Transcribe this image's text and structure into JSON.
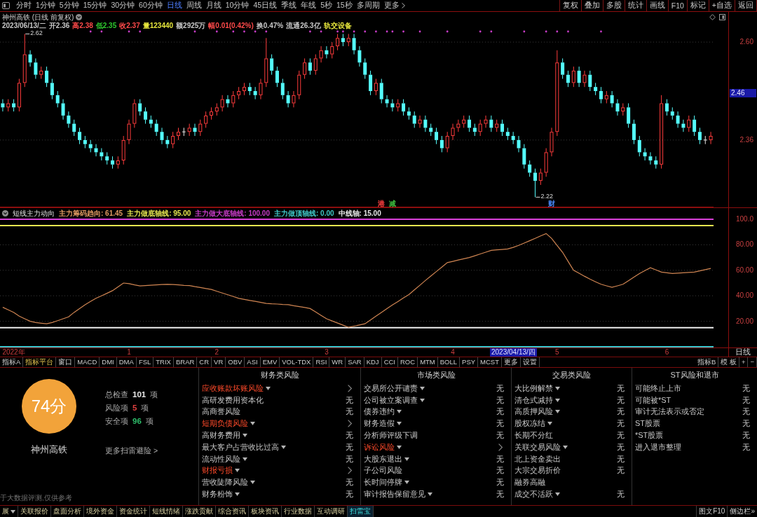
{
  "toolbar": {
    "periods": [
      {
        "label": "分时",
        "selected": false
      },
      {
        "label": "1分钟",
        "selected": false
      },
      {
        "label": "5分钟",
        "selected": false
      },
      {
        "label": "15分钟",
        "selected": false
      },
      {
        "label": "30分钟",
        "selected": false
      },
      {
        "label": "60分钟",
        "selected": false
      },
      {
        "label": "日线",
        "selected": true
      },
      {
        "label": "周线",
        "selected": false
      },
      {
        "label": "月线",
        "selected": false
      },
      {
        "label": "10分钟",
        "selected": false
      },
      {
        "label": "45日线",
        "selected": false
      },
      {
        "label": "季线",
        "selected": false
      },
      {
        "label": "年线",
        "selected": false
      },
      {
        "label": "5秒",
        "selected": false
      },
      {
        "label": "15秒",
        "selected": false
      },
      {
        "label": "多周期",
        "selected": false
      }
    ],
    "more": "更多",
    "actions": [
      "复权",
      "叠加",
      "多股",
      "统计",
      "画线",
      "F10",
      "标记",
      "+自选",
      "返回"
    ]
  },
  "price_pane": {
    "title": "神州高铁 (日线 前复权)",
    "quote": [
      {
        "text": "2023/06/13/二",
        "color": "#c8c8c8"
      },
      {
        "text": "开2.36",
        "color": "#c8c8c8"
      },
      {
        "text": "高2.38",
        "color": "#ff4a4a"
      },
      {
        "text": "低2.35",
        "color": "#2ec82e"
      },
      {
        "text": "收2.37",
        "color": "#ff4a4a"
      },
      {
        "text": "量123440",
        "color": "#e6e63c"
      },
      {
        "text": "额2925万",
        "color": "#c8c8c8"
      },
      {
        "text": "幅0.01(0.42%)",
        "color": "#ff4a4a"
      },
      {
        "text": "换0.47%",
        "color": "#c8c8c8"
      },
      {
        "text": "流通26.3亿",
        "color": "#c8c8c8"
      },
      {
        "text": "轨交设备",
        "color": "#e6e63c"
      }
    ],
    "cursor_price": "2.46",
    "event_tags": [
      {
        "label": "港",
        "color": "#ff4040"
      },
      {
        "label": "减",
        "color": "#40c040"
      },
      {
        "label": "财",
        "color": "#4a8cff"
      }
    ],
    "chart_data": [
      {
        "type": "candlestick",
        "ylim": [
          2.195,
          2.674
        ],
        "yticks": [
          {
            "value": 2.6,
            "label": "2.60"
          },
          {
            "value": 2.36,
            "label": "2.36"
          }
        ],
        "grid": true,
        "annotations": [
          "2.62",
          "2.22"
        ],
        "ohlc": [
          [
            2.45,
            2.46,
            2.43,
            2.44
          ],
          [
            2.44,
            2.46,
            2.43,
            2.45
          ],
          [
            2.45,
            2.46,
            2.43,
            2.44
          ],
          [
            2.44,
            2.51,
            2.43,
            2.5
          ],
          [
            2.5,
            2.62,
            2.49,
            2.57
          ],
          [
            2.57,
            2.58,
            2.54,
            2.55
          ],
          [
            2.55,
            2.56,
            2.51,
            2.52
          ],
          [
            2.52,
            2.54,
            2.51,
            2.53
          ],
          [
            2.53,
            2.54,
            2.49,
            2.5
          ],
          [
            2.5,
            2.51,
            2.46,
            2.47
          ],
          [
            2.47,
            2.48,
            2.44,
            2.45
          ],
          [
            2.45,
            2.46,
            2.41,
            2.42
          ],
          [
            2.42,
            2.43,
            2.39,
            2.4
          ],
          [
            2.4,
            2.41,
            2.37,
            2.38
          ],
          [
            2.38,
            2.39,
            2.35,
            2.36
          ],
          [
            2.36,
            2.37,
            2.34,
            2.35
          ],
          [
            2.35,
            2.36,
            2.33,
            2.34
          ],
          [
            2.34,
            2.35,
            2.32,
            2.33
          ],
          [
            2.33,
            2.34,
            2.31,
            2.32
          ],
          [
            2.32,
            2.33,
            2.3,
            2.31
          ],
          [
            2.31,
            2.32,
            2.29,
            2.3
          ],
          [
            2.3,
            2.32,
            2.29,
            2.31
          ],
          [
            2.31,
            2.37,
            2.3,
            2.36
          ],
          [
            2.36,
            2.41,
            2.35,
            2.4
          ],
          [
            2.4,
            2.46,
            2.39,
            2.45
          ],
          [
            2.45,
            2.46,
            2.42,
            2.43
          ],
          [
            2.43,
            2.44,
            2.4,
            2.41
          ],
          [
            2.41,
            2.42,
            2.39,
            2.4
          ],
          [
            2.4,
            2.41,
            2.37,
            2.38
          ],
          [
            2.38,
            2.39,
            2.35,
            2.36
          ],
          [
            2.36,
            2.37,
            2.34,
            2.35
          ],
          [
            2.35,
            2.38,
            2.34,
            2.37
          ],
          [
            2.37,
            2.39,
            2.36,
            2.38
          ],
          [
            2.38,
            2.39,
            2.37,
            2.38
          ],
          [
            2.38,
            2.4,
            2.37,
            2.39
          ],
          [
            2.39,
            2.4,
            2.37,
            2.38
          ],
          [
            2.38,
            2.41,
            2.37,
            2.4
          ],
          [
            2.4,
            2.43,
            2.39,
            2.42
          ],
          [
            2.42,
            2.44,
            2.41,
            2.43
          ],
          [
            2.43,
            2.45,
            2.42,
            2.44
          ],
          [
            2.44,
            2.47,
            2.43,
            2.46
          ],
          [
            2.46,
            2.47,
            2.44,
            2.45
          ],
          [
            2.45,
            2.48,
            2.44,
            2.47
          ],
          [
            2.47,
            2.49,
            2.46,
            2.48
          ],
          [
            2.48,
            2.5,
            2.47,
            2.49
          ],
          [
            2.49,
            2.5,
            2.47,
            2.48
          ],
          [
            2.48,
            2.49,
            2.46,
            2.47
          ],
          [
            2.47,
            2.51,
            2.46,
            2.5
          ],
          [
            2.5,
            2.61,
            2.49,
            2.56
          ],
          [
            2.56,
            2.57,
            2.52,
            2.53
          ],
          [
            2.53,
            2.54,
            2.49,
            2.5
          ],
          [
            2.5,
            2.51,
            2.46,
            2.47
          ],
          [
            2.47,
            2.48,
            2.44,
            2.45
          ],
          [
            2.45,
            2.48,
            2.44,
            2.47
          ],
          [
            2.47,
            2.53,
            2.46,
            2.52
          ],
          [
            2.52,
            2.56,
            2.51,
            2.55
          ],
          [
            2.55,
            2.56,
            2.52,
            2.53
          ],
          [
            2.53,
            2.57,
            2.52,
            2.56
          ],
          [
            2.56,
            2.59,
            2.55,
            2.58
          ],
          [
            2.58,
            2.59,
            2.56,
            2.57
          ],
          [
            2.57,
            2.6,
            2.56,
            2.59
          ],
          [
            2.59,
            2.62,
            2.58,
            2.61
          ],
          [
            2.61,
            2.62,
            2.59,
            2.6
          ],
          [
            2.6,
            2.62,
            2.59,
            2.61
          ],
          [
            2.61,
            2.62,
            2.57,
            2.58
          ],
          [
            2.58,
            2.59,
            2.54,
            2.55
          ],
          [
            2.55,
            2.56,
            2.51,
            2.52
          ],
          [
            2.52,
            2.53,
            2.47,
            2.48
          ],
          [
            2.48,
            2.51,
            2.47,
            2.5
          ],
          [
            2.5,
            2.51,
            2.45,
            2.46
          ],
          [
            2.46,
            2.47,
            2.44,
            2.45
          ],
          [
            2.45,
            2.46,
            2.43,
            2.44
          ],
          [
            2.44,
            2.46,
            2.43,
            2.45
          ],
          [
            2.45,
            2.46,
            2.42,
            2.43
          ],
          [
            2.43,
            2.44,
            2.41,
            2.42
          ],
          [
            2.42,
            2.43,
            2.39,
            2.4
          ],
          [
            2.4,
            2.42,
            2.39,
            2.41
          ],
          [
            2.41,
            2.42,
            2.38,
            2.39
          ],
          [
            2.39,
            2.4,
            2.37,
            2.38
          ],
          [
            2.38,
            2.39,
            2.35,
            2.36
          ],
          [
            2.36,
            2.37,
            2.33,
            2.34
          ],
          [
            2.34,
            2.38,
            2.33,
            2.37
          ],
          [
            2.37,
            2.4,
            2.36,
            2.39
          ],
          [
            2.39,
            2.41,
            2.38,
            2.4
          ],
          [
            2.4,
            2.42,
            2.39,
            2.41
          ],
          [
            2.41,
            2.42,
            2.38,
            2.39
          ],
          [
            2.39,
            2.4,
            2.37,
            2.38
          ],
          [
            2.38,
            2.41,
            2.37,
            2.4
          ],
          [
            2.4,
            2.42,
            2.39,
            2.41
          ],
          [
            2.41,
            2.42,
            2.38,
            2.39
          ],
          [
            2.39,
            2.41,
            2.38,
            2.4
          ],
          [
            2.4,
            2.41,
            2.37,
            2.38
          ],
          [
            2.38,
            2.39,
            2.36,
            2.37
          ],
          [
            2.37,
            2.38,
            2.35,
            2.36
          ],
          [
            2.36,
            2.37,
            2.33,
            2.34
          ],
          [
            2.34,
            2.35,
            2.29,
            2.3
          ],
          [
            2.3,
            2.31,
            2.27,
            2.28
          ],
          [
            2.28,
            2.29,
            2.22,
            2.26
          ],
          [
            2.26,
            2.29,
            2.25,
            2.28
          ],
          [
            2.28,
            2.34,
            2.27,
            2.33
          ],
          [
            2.33,
            2.39,
            2.32,
            2.38
          ],
          [
            2.38,
            2.58,
            2.37,
            2.55
          ],
          [
            2.55,
            2.56,
            2.51,
            2.52
          ],
          [
            2.52,
            2.53,
            2.49,
            2.5
          ],
          [
            2.5,
            2.54,
            2.49,
            2.53
          ],
          [
            2.53,
            2.54,
            2.49,
            2.5
          ],
          [
            2.5,
            2.53,
            2.49,
            2.52
          ],
          [
            2.52,
            2.53,
            2.48,
            2.49
          ],
          [
            2.49,
            2.5,
            2.47,
            2.48
          ],
          [
            2.48,
            2.49,
            2.45,
            2.46
          ],
          [
            2.46,
            2.48,
            2.45,
            2.47
          ],
          [
            2.47,
            2.48,
            2.44,
            2.45
          ],
          [
            2.45,
            2.46,
            2.42,
            2.43
          ],
          [
            2.43,
            2.45,
            2.42,
            2.44
          ],
          [
            2.44,
            2.45,
            2.39,
            2.4
          ],
          [
            2.4,
            2.41,
            2.35,
            2.36
          ],
          [
            2.36,
            2.37,
            2.32,
            2.33
          ],
          [
            2.33,
            2.34,
            2.31,
            2.32
          ],
          [
            2.32,
            2.33,
            2.3,
            2.31
          ],
          [
            2.31,
            2.32,
            2.29,
            2.3
          ],
          [
            2.3,
            2.47,
            2.29,
            2.45
          ],
          [
            2.45,
            2.46,
            2.42,
            2.43
          ],
          [
            2.43,
            2.44,
            2.41,
            2.42
          ],
          [
            2.42,
            2.43,
            2.39,
            2.4
          ],
          [
            2.4,
            2.41,
            2.38,
            2.39
          ],
          [
            2.39,
            2.42,
            2.38,
            2.41
          ],
          [
            2.41,
            2.42,
            2.37,
            2.38
          ],
          [
            2.38,
            2.39,
            2.35,
            2.36
          ],
          [
            2.36,
            2.37,
            2.35,
            2.36
          ],
          [
            2.36,
            2.38,
            2.35,
            2.37
          ]
        ]
      }
    ]
  },
  "indicator_pane": {
    "title": "短线主力动向",
    "legend": [
      {
        "label": "主力筹码趋向: 61.45",
        "color": "#e09a62"
      },
      {
        "label": "主力做底轴线: 95.00",
        "color": "#e6e650"
      },
      {
        "label": "主力做大底轴线: 100.00",
        "color": "#c83cc8"
      },
      {
        "label": "主力做顶轴线: 0.00",
        "color": "#40c8c8"
      },
      {
        "label": "中线轴: 15.00",
        "color": "#e8e8e8"
      }
    ],
    "chart_data": [
      {
        "type": "line",
        "ylim": [
          -0.55,
          108.8
        ],
        "yticks": [
          {
            "value": 100,
            "label": "100.0"
          },
          {
            "value": 80,
            "label": "80.00"
          },
          {
            "value": 60,
            "label": "60.00"
          },
          {
            "value": 40,
            "label": "40.00"
          },
          {
            "value": 20,
            "label": "20.00"
          }
        ],
        "grid": true,
        "categories": [
          null,
          null,
          "2022年",
          null,
          null,
          null,
          null,
          null,
          null,
          null,
          null,
          null,
          null,
          null,
          null,
          null,
          null,
          null,
          null,
          null,
          null,
          null,
          null,
          "1",
          null,
          null,
          null,
          null,
          null,
          null,
          null,
          null,
          null,
          null,
          null,
          null,
          null,
          null,
          null,
          "2",
          null,
          null,
          null,
          null,
          null,
          null,
          null,
          null,
          null,
          null,
          null,
          null,
          null,
          null,
          null,
          null,
          null,
          null,
          null,
          "3",
          null,
          null,
          null,
          null,
          null,
          null,
          null,
          null,
          null,
          null,
          null,
          null,
          null,
          null,
          null,
          null,
          null,
          null,
          null,
          null,
          null,
          null,
          "4",
          null,
          null,
          null,
          null,
          null,
          null,
          null,
          null,
          null,
          null,
          null,
          null,
          null,
          null,
          null,
          null,
          null,
          null,
          "5",
          null,
          null,
          null,
          null,
          null,
          null,
          null,
          null,
          null,
          null,
          null,
          null,
          null,
          null,
          null,
          null,
          null,
          null,
          null,
          "6",
          null,
          null,
          null,
          null,
          null,
          null,
          null,
          null
        ],
        "series": [
          {
            "color": "#d08552",
            "values": [
              31,
              29,
              27,
              24,
              22,
              20,
              19,
              18.5,
              18,
              19,
              20.5,
              22,
              23.5,
              27,
              30,
              33,
              35.6,
              38,
              40,
              42,
              44,
              47,
              50,
              49.5,
              48.5,
              47.7,
              48,
              48.3,
              48.6,
              48.8,
              49,
              48.8,
              48.5,
              48.2,
              48,
              47.2,
              46.5,
              45.7,
              45,
              43.6,
              42.2,
              40.8,
              39.4,
              38,
              37.2,
              36.4,
              35.6,
              34.8,
              34,
              33.7,
              33.5,
              33.2,
              33,
              32.2,
              31.5,
              30.8,
              30,
              27.3,
              24.6,
              22,
              20.3,
              18.6,
              17,
              15.3,
              16.2,
              17.1,
              18,
              21,
              24,
              27,
              30,
              32.8,
              35.5,
              38.3,
              41,
              44.7,
              48.3,
              52,
              55.5,
              59,
              62.5,
              66,
              67,
              68,
              69,
              70,
              71.4,
              72.8,
              74.2,
              75.6,
              76,
              76.3,
              76.7,
              78,
              79.5,
              81.3,
              83.2,
              85,
              87,
              88.8,
              85,
              79.5,
              74,
              67,
              60,
              57.7,
              55.3,
              53,
              51,
              49,
              47.8,
              46.6,
              47.8,
              49,
              51.8,
              54.7,
              57.5,
              59.8,
              62,
              60.3,
              58.6,
              58,
              57.5,
              57.8,
              58,
              58.3,
              58.6,
              59.5,
              60.5,
              61.45
            ]
          }
        ],
        "ref_lines": [
          {
            "axis": "y",
            "value": 100,
            "color": "#d840d8"
          },
          {
            "axis": "y",
            "value": 95,
            "color": "#e6e650"
          },
          {
            "axis": "y",
            "value": 15,
            "color": "#f0f0f0"
          },
          {
            "axis": "y",
            "value": 0,
            "color": "#3cc8d0"
          }
        ]
      }
    ]
  },
  "time_axis": {
    "cursor_date": "2023/04/13/四",
    "period_label": "日线"
  },
  "indicator_tabs": {
    "items": [
      {
        "label": "指标A",
        "kind": "tab"
      },
      {
        "label": "指标平台",
        "kind": "link"
      },
      {
        "label": "窗口",
        "kind": "tab"
      },
      {
        "label": "MACD",
        "kind": "tab"
      },
      {
        "label": "DMI",
        "kind": "tab"
      },
      {
        "label": "DMA",
        "kind": "tab"
      },
      {
        "label": "FSL",
        "kind": "tab"
      },
      {
        "label": "TRIX",
        "kind": "tab"
      },
      {
        "label": "BRAR",
        "kind": "tab"
      },
      {
        "label": "CR",
        "kind": "tab"
      },
      {
        "label": "VR",
        "kind": "tab"
      },
      {
        "label": "OBV",
        "kind": "tab"
      },
      {
        "label": "ASI",
        "kind": "tab"
      },
      {
        "label": "EMV",
        "kind": "tab"
      },
      {
        "label": "VOL-TDX",
        "kind": "tab"
      },
      {
        "label": "RSI",
        "kind": "tab"
      },
      {
        "label": "WR",
        "kind": "tab"
      },
      {
        "label": "SAR",
        "kind": "tab"
      },
      {
        "label": "KDJ",
        "kind": "tab"
      },
      {
        "label": "CCI",
        "kind": "tab"
      },
      {
        "label": "ROC",
        "kind": "tab"
      },
      {
        "label": "MTM",
        "kind": "tab"
      },
      {
        "label": "BOLL",
        "kind": "tab"
      },
      {
        "label": "PSY",
        "kind": "tab"
      },
      {
        "label": "MCST",
        "kind": "tab"
      },
      {
        "label": "更多",
        "kind": "tab"
      },
      {
        "label": "设置",
        "kind": "tab"
      }
    ],
    "right": [
      "指标B",
      "模 板",
      "+",
      "−"
    ]
  },
  "risk_panel": {
    "score": "74分",
    "stock": "神州高铁",
    "stats": [
      {
        "label": "总检查",
        "value": "101",
        "unit": "项",
        "color": "#e6e6e6"
      },
      {
        "label": "风险项",
        "value": "5",
        "unit": "项",
        "color": "#e04040"
      },
      {
        "label": "安全项",
        "value": "96",
        "unit": "项",
        "color": "#2ebd6a"
      }
    ],
    "more_link": "更多扫雷避险 >",
    "disclaimer": "于大数据评测,仅供参考",
    "columns": [
      {
        "title": "财务类风险",
        "items": [
          {
            "name": "应收账款坏账风险",
            "dropdown": true,
            "risk": true
          },
          {
            "name": "高研发费用资本化",
            "dropdown": false,
            "risk": false,
            "result": "无"
          },
          {
            "name": "高商誉风险",
            "dropdown": false,
            "risk": false,
            "result": "无"
          },
          {
            "name": "短期负债风险",
            "dropdown": true,
            "risk": true
          },
          {
            "name": "高财务费用",
            "dropdown": true,
            "risk": false,
            "result": "无"
          },
          {
            "name": "最大客户占营收比过高",
            "dropdown": true,
            "risk": false,
            "result": "无"
          },
          {
            "name": "流动性风险",
            "dropdown": true,
            "risk": false,
            "result": "无"
          },
          {
            "name": "财报亏损",
            "dropdown": true,
            "risk": true
          },
          {
            "name": "营收陡降风险",
            "dropdown": true,
            "risk": false,
            "result": "无"
          },
          {
            "name": "财务粉饰",
            "dropdown": true,
            "risk": false,
            "result": "无"
          }
        ]
      },
      {
        "title": "市场类风险",
        "items": [
          {
            "name": "交易所公开谴责",
            "dropdown": true,
            "risk": false,
            "result": "无"
          },
          {
            "name": "公司被立案调查",
            "dropdown": true,
            "risk": false,
            "result": "无"
          },
          {
            "name": "债券违约",
            "dropdown": true,
            "risk": false,
            "result": "无"
          },
          {
            "name": "财务造假",
            "dropdown": true,
            "risk": false,
            "result": "无"
          },
          {
            "name": "分析师评级下调",
            "dropdown": false,
            "risk": false,
            "result": "无"
          },
          {
            "name": "诉讼风险",
            "dropdown": true,
            "risk": true
          },
          {
            "name": "大股东退出",
            "dropdown": true,
            "risk": false,
            "result": "无"
          },
          {
            "name": "子公司风险",
            "dropdown": false,
            "risk": false,
            "result": "无"
          },
          {
            "name": "长时间停牌",
            "dropdown": true,
            "risk": false,
            "result": "无"
          },
          {
            "name": "审计报告保留意见",
            "dropdown": true,
            "risk": false,
            "result": "无"
          }
        ]
      },
      {
        "title": "交易类风险",
        "items": [
          {
            "name": "大比例解禁",
            "dropdown": true,
            "risk": false,
            "result": "无"
          },
          {
            "name": "清仓式减持",
            "dropdown": true,
            "risk": false,
            "result": "无"
          },
          {
            "name": "高质押风险",
            "dropdown": true,
            "risk": false,
            "result": "无"
          },
          {
            "name": "股权冻结",
            "dropdown": true,
            "risk": false,
            "result": "无"
          },
          {
            "name": "长期不分红",
            "dropdown": false,
            "risk": false,
            "result": "无"
          },
          {
            "name": "关联交易风险",
            "dropdown": true,
            "risk": false,
            "result": "无"
          },
          {
            "name": "北上资金卖出",
            "dropdown": false,
            "risk": false,
            "result": "无"
          },
          {
            "name": "大宗交易折价",
            "dropdown": false,
            "risk": false,
            "result": "无"
          },
          {
            "name": "融券高融",
            "dropdown": false,
            "risk": false
          },
          {
            "name": "成交不活跃",
            "dropdown": true,
            "risk": false,
            "result": "无"
          }
        ]
      },
      {
        "title": "ST风险和退市",
        "items": [
          {
            "name": "可能终止上市",
            "dropdown": false,
            "risk": false,
            "result": "无"
          },
          {
            "name": "可能被*ST",
            "dropdown": false,
            "risk": false,
            "result": "无"
          },
          {
            "name": "审计无法表示或否定",
            "dropdown": false,
            "risk": false,
            "result": "无"
          },
          {
            "name": "ST股票",
            "dropdown": false,
            "risk": false,
            "result": "无"
          },
          {
            "name": "*ST股票",
            "dropdown": false,
            "risk": false,
            "result": "无"
          },
          {
            "name": "进入退市整理",
            "dropdown": false,
            "risk": false,
            "result": "无"
          }
        ]
      }
    ]
  },
  "bottom_tabs": {
    "items": [
      {
        "label": "展",
        "dropdown": true,
        "selected": false
      },
      {
        "label": "关联报价",
        "dropdown": false,
        "selected": false
      },
      {
        "label": "盘面分析",
        "dropdown": false,
        "selected": false
      },
      {
        "label": "境外资金",
        "dropdown": false,
        "selected": false
      },
      {
        "label": "资金统计",
        "dropdown": false,
        "selected": false
      },
      {
        "label": "短线情绪",
        "dropdown": false,
        "selected": false
      },
      {
        "label": "涨跌贡献",
        "dropdown": false,
        "selected": false
      },
      {
        "label": "综合资讯",
        "dropdown": false,
        "selected": false
      },
      {
        "label": "板块资讯",
        "dropdown": false,
        "selected": false
      },
      {
        "label": "行业数据",
        "dropdown": false,
        "selected": false
      },
      {
        "label": "互动调研",
        "dropdown": false,
        "selected": false
      },
      {
        "label": "扫雷宝",
        "dropdown": false,
        "selected": true
      }
    ],
    "right": [
      "图文F10",
      "侧边栏»"
    ]
  }
}
